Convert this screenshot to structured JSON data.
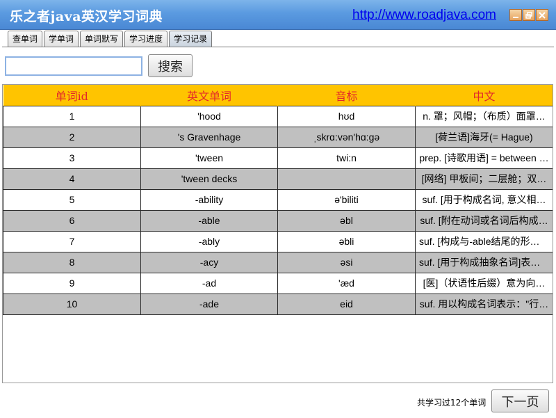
{
  "window": {
    "title": "乐之者java英汉学习词典",
    "url": "http://www.roadjava.com",
    "controls": [
      "minimize-icon",
      "maximize-icon",
      "close-icon"
    ]
  },
  "tabs": [
    {
      "label": "查单词",
      "active": false
    },
    {
      "label": "学单词",
      "active": false
    },
    {
      "label": "单词默写",
      "active": false
    },
    {
      "label": "学习进度",
      "active": false
    },
    {
      "label": "学习记录",
      "active": true
    }
  ],
  "search": {
    "value": "",
    "button_label": "搜索"
  },
  "table": {
    "columns": [
      "单词id",
      "英文单词",
      "音标",
      "中文"
    ],
    "rows": [
      [
        "1",
        "'hood",
        "hʊd",
        "n. 罩；风帽；（布质）面罩…"
      ],
      [
        "2",
        "'s Gravenhage",
        "ˌskrɑ:vən'hɑ:ɡə",
        "[荷兰语]海牙(= Hague)"
      ],
      [
        "3",
        "'tween",
        "twi:n",
        "prep. [诗歌用语] = between …"
      ],
      [
        "4",
        "'tween decks",
        "",
        "[网络] 甲板间；二层舱；双…"
      ],
      [
        "5",
        "-ability",
        "ə'biliti",
        "suf. [用于构成名词, 意义相…"
      ],
      [
        "6",
        "-able",
        "əbl",
        "suf. [附在动词或名词后构成…"
      ],
      [
        "7",
        "-ably",
        "əbli",
        "suf. [构成与-able结尾的形容…"
      ],
      [
        "8",
        "-acy",
        "əsi",
        "suf. [用于构成抽象名词]表示…"
      ],
      [
        "9",
        "-ad",
        "'æd",
        "[医]（状语性后缀）意为向…"
      ],
      [
        "10",
        "-ade",
        "eid",
        "suf. 用以构成名词表示：\"行…"
      ]
    ]
  },
  "footer": {
    "summary": "共学习过12个单词",
    "next_label": "下一页"
  },
  "colors": {
    "titlebar": "#5a9ae0",
    "header_bg": "#ffc400",
    "header_text": "#e3282a",
    "alt_row": "#c0c0c0",
    "link": "#0000ee"
  }
}
